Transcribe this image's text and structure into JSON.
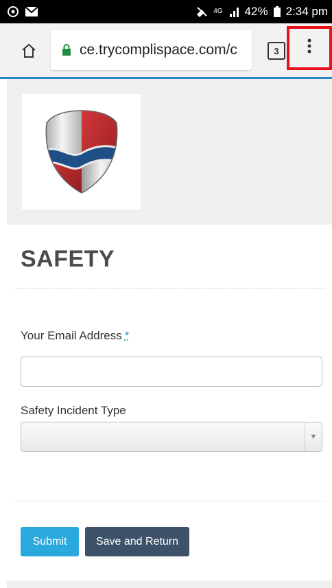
{
  "status_bar": {
    "network": "4G",
    "battery": "42%",
    "time": "2:34 pm"
  },
  "browser": {
    "url": "ce.trycomplispace.com/c",
    "tab_count": "3"
  },
  "form": {
    "title": "SAFETY",
    "email_label": "Your Email Address",
    "required_marker": "*",
    "email_value": "",
    "incident_label": "Safety Incident Type",
    "incident_value": "",
    "submit_label": "Submit",
    "save_label": "Save and Return"
  },
  "colors": {
    "accent_line": "#2b86c6",
    "menu_highlight": "#e8121b",
    "submit_button": "#29a9dc",
    "save_button": "#3d5268"
  }
}
